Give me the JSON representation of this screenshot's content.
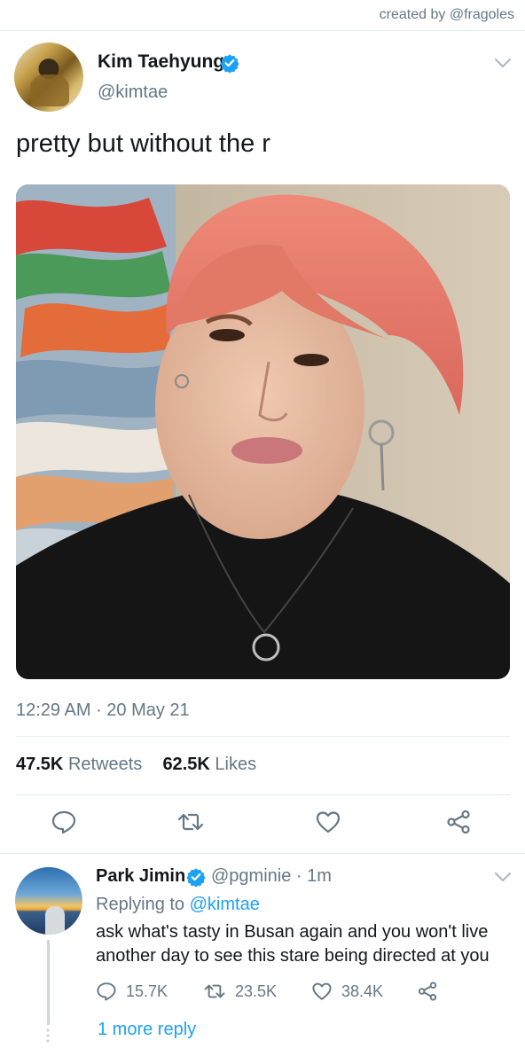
{
  "credit": "created by @fragoles",
  "tweet": {
    "author_name": "Kim Taehyung",
    "author_handle": "@kimtae",
    "text": "pretty but without the r",
    "timestamp": "12:29 AM · 20 May 21",
    "retweets_count": "47.5K",
    "retweets_label": "Retweets",
    "likes_count": "62.5K",
    "likes_label": "Likes"
  },
  "reply": {
    "author_name": "Park Jimin",
    "author_handle": "@pgminie",
    "time": "· 1m",
    "replying_prefix": "Replying to",
    "replying_mention": "@kimtae",
    "text": "ask what's tasty in Busan again and you won't live another day to see this stare being directed at you",
    "reply_count": "15.7K",
    "retweet_count": "23.5K",
    "like_count": "38.4K",
    "more_replies": "1 more reply"
  },
  "colors": {
    "accent": "#1da1f2",
    "secondary_text": "#657786",
    "primary_text": "#14171a",
    "divider": "#e6ecf0"
  },
  "icons": {
    "verified": "verified-badge-icon",
    "caret": "chevron-down-icon",
    "reply": "reply-bubble-icon",
    "retweet": "retweet-icon",
    "like": "heart-icon",
    "share": "share-icon"
  }
}
